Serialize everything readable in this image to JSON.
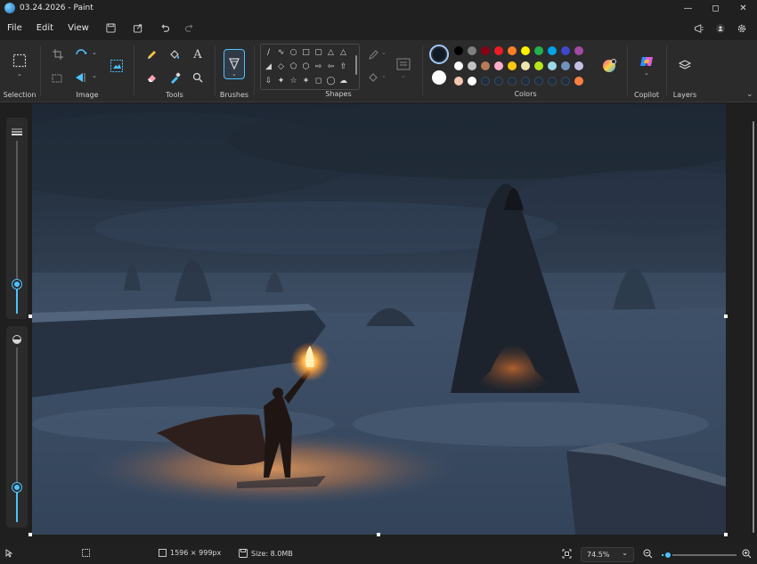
{
  "window": {
    "title": "03.24.2026 - Paint",
    "controls": [
      "minimize-icon",
      "maximize-icon",
      "close-icon"
    ]
  },
  "menu": {
    "items": [
      "File",
      "Edit",
      "View"
    ],
    "quick_actions": [
      "save-icon",
      "share-icon",
      "undo-icon",
      "redo-icon"
    ]
  },
  "ribbon": {
    "groups": {
      "selection": "Selection",
      "image": "Image",
      "tools": "Tools",
      "brushes": "Brushes",
      "shapes": "Shapes",
      "colors": "Colors",
      "copilot": "Copilot",
      "layers": "Layers"
    },
    "tools_text_glyph": "A",
    "colors": {
      "primary": "#0f1a26",
      "secondary": "#ffffff",
      "palette_row1": [
        "#000000",
        "#7f7f7f",
        "#880015",
        "#ed1c24",
        "#ff7f27",
        "#fff200",
        "#22b14c",
        "#00a2e8",
        "#3f48cc",
        "#a349a4"
      ],
      "palette_row2": [
        "#ffffff",
        "#c3c3c3",
        "#b97a57",
        "#ffaec9",
        "#ffc90e",
        "#efe4b0",
        "#b5e61d",
        "#99d9ea",
        "#7092be",
        "#c8bfe7"
      ],
      "palette_row3": [
        "#f5c6b0",
        "#ffffff",
        "#1f2d3d",
        "#1f2d3d",
        "#1f2d3d",
        "#1f2d3d",
        "#1f2d3d",
        "#1f2d3d",
        "#1f2d3d",
        "#ff8040"
      ]
    }
  },
  "sliders": {
    "brush_size_level": 0.17,
    "opacity_level": 0.2
  },
  "status": {
    "dimensions": "1596 × 999px",
    "size": "Size: 8.0MB",
    "zoom": "74.5%",
    "zoom_level": 0.08
  }
}
